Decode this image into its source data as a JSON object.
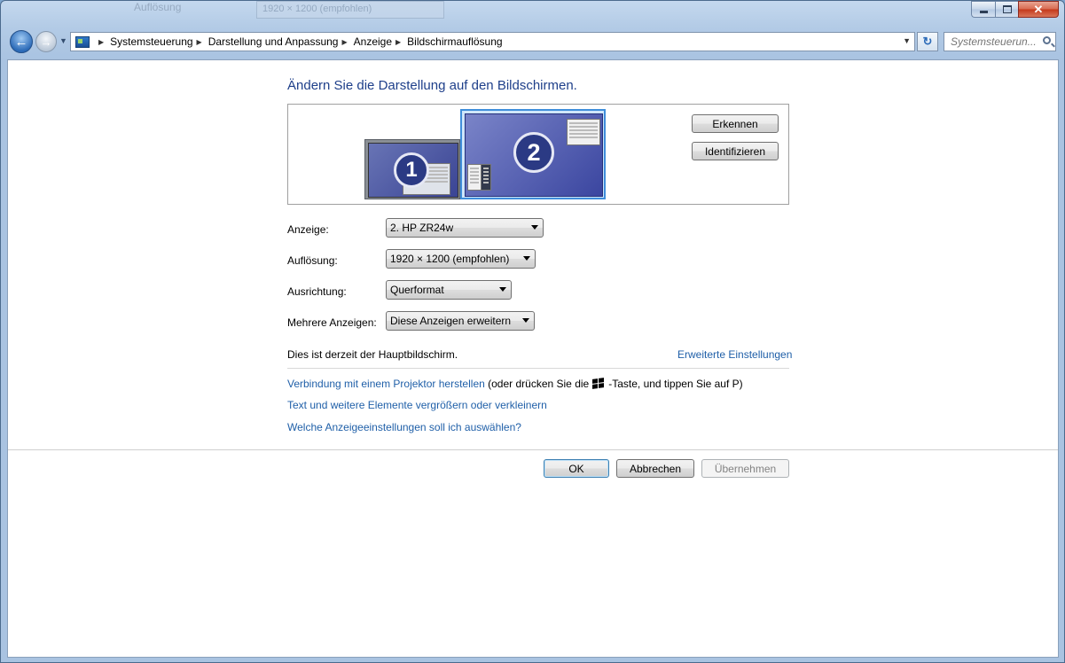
{
  "window": {
    "background_ghost": {
      "label": "Auflösung",
      "value": "1920 × 1200 (empfohlen)"
    },
    "caption": {
      "minimize": "–",
      "maximize": "□",
      "close": "✕"
    }
  },
  "nav": {
    "back_glyph": "←",
    "forward_glyph": "→",
    "recent_glyph": "▼",
    "address_icon": "control-panel-icon",
    "breadcrumbs": [
      "Systemsteuerung",
      "Darstellung und Anpassung",
      "Anzeige",
      "Bildschirmauflösung"
    ],
    "crumb_separator": "▶",
    "address_dropdown_glyph": "▼",
    "refresh_glyph": "↻",
    "search_placeholder": "Systemsteuerun..."
  },
  "main": {
    "heading": "Ändern Sie die Darstellung auf den Bildschirmen.",
    "monitors": [
      {
        "number": "1",
        "selected": false
      },
      {
        "number": "2",
        "selected": true
      }
    ],
    "detect_button": "Erkennen",
    "identify_button": "Identifizieren",
    "fields": {
      "display": {
        "label": "Anzeige:",
        "value": "2. HP ZR24w"
      },
      "resolution": {
        "label": "Auflösung:",
        "value": "1920 × 1200 (empfohlen)"
      },
      "orientation": {
        "label": "Ausrichtung:",
        "value": "Querformat"
      },
      "multiple": {
        "label": "Mehrere Anzeigen:",
        "value": "Diese Anzeigen erweitern"
      }
    },
    "primary_note": "Dies ist derzeit der Hauptbildschirm.",
    "advanced_link": "Erweiterte Einstellungen",
    "projector_link": "Verbindung mit einem Projektor herstellen",
    "projector_hint_before": "(oder drücken Sie die",
    "projector_hint_after": "-Taste, und tippen Sie auf P)",
    "text_size_link": "Text und weitere Elemente vergrößern oder verkleinern",
    "which_settings_link": "Welche Anzeigeeinstellungen soll ich auswählen?",
    "ok_button": "OK",
    "cancel_button": "Abbrechen",
    "apply_button": "Übernehmen"
  },
  "colors": {
    "link": "#1f5fa8",
    "heading": "#1e3f8a",
    "selection": "#3f8edb"
  }
}
